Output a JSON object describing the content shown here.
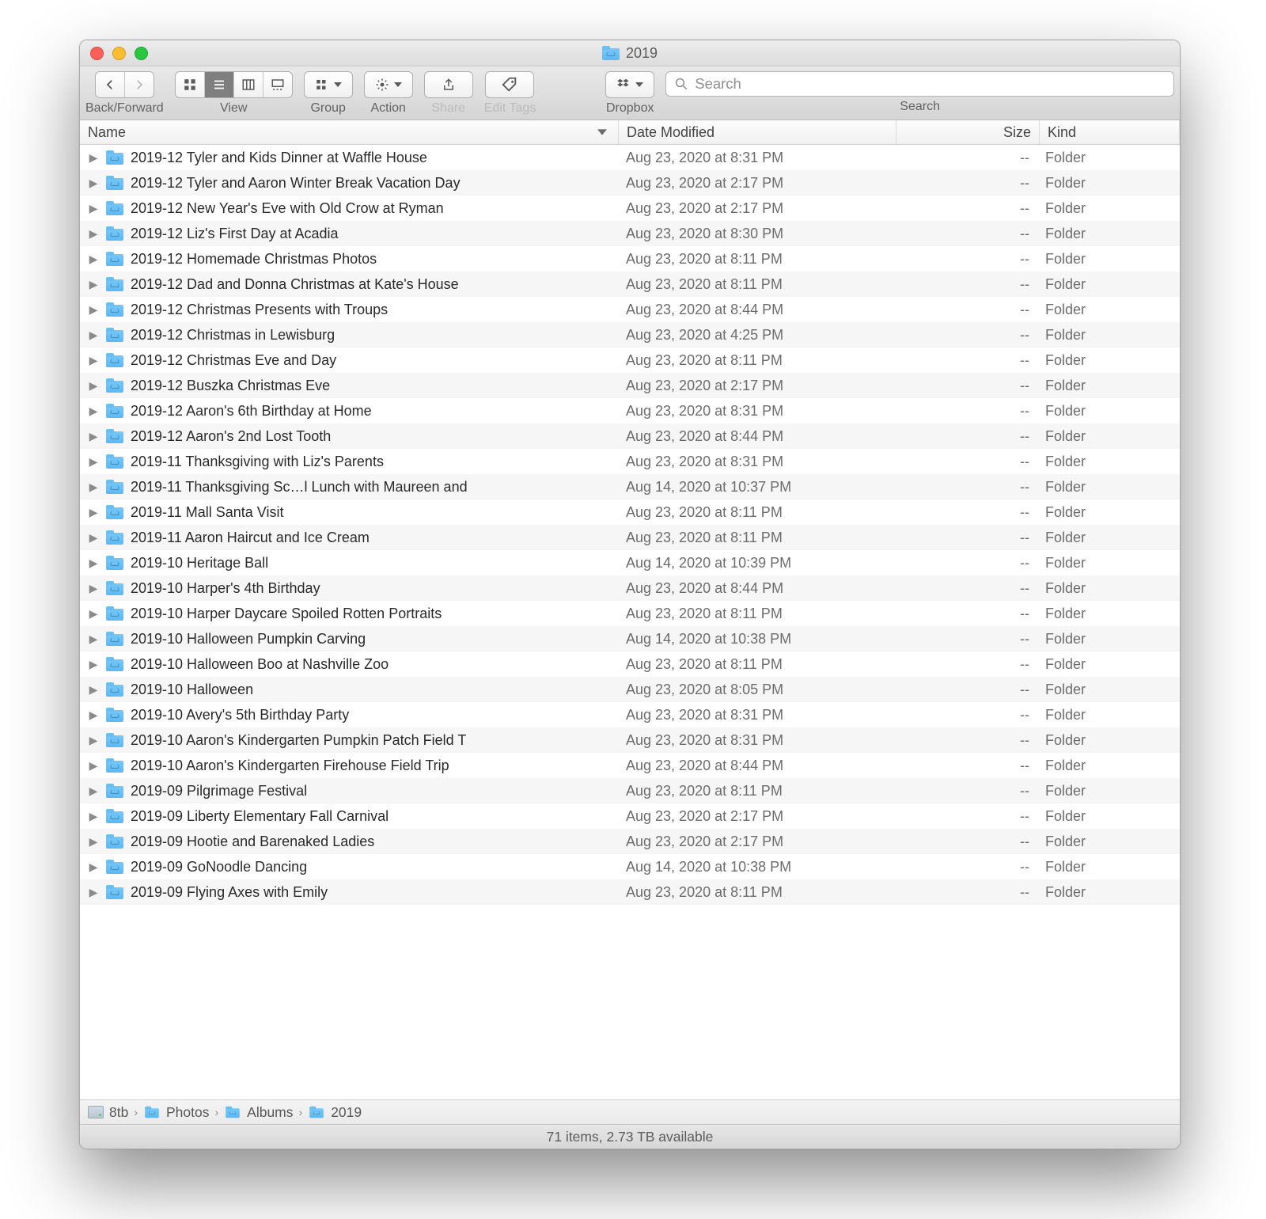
{
  "window": {
    "title": "2019"
  },
  "toolbar": {
    "back_forward_label": "Back/Forward",
    "view_label": "View",
    "group_label": "Group",
    "action_label": "Action",
    "share_label": "Share",
    "tags_label": "Edit Tags",
    "dropbox_label": "Dropbox",
    "search_label": "Search",
    "search_placeholder": "Search"
  },
  "columns": {
    "name": "Name",
    "date": "Date Modified",
    "size": "Size",
    "kind": "Kind"
  },
  "items": [
    {
      "name": "2019-12 Tyler and Kids Dinner at Waffle House",
      "date": "Aug 23, 2020 at 8:31 PM",
      "size": "--",
      "kind": "Folder"
    },
    {
      "name": "2019-12 Tyler and Aaron Winter Break Vacation Day",
      "date": "Aug 23, 2020 at 2:17 PM",
      "size": "--",
      "kind": "Folder"
    },
    {
      "name": "2019-12 New Year's Eve with Old Crow at Ryman",
      "date": "Aug 23, 2020 at 2:17 PM",
      "size": "--",
      "kind": "Folder"
    },
    {
      "name": "2019-12 Liz's First Day at Acadia",
      "date": "Aug 23, 2020 at 8:30 PM",
      "size": "--",
      "kind": "Folder"
    },
    {
      "name": "2019-12 Homemade Christmas Photos",
      "date": "Aug 23, 2020 at 8:11 PM",
      "size": "--",
      "kind": "Folder"
    },
    {
      "name": "2019-12 Dad and Donna Christmas at Kate's House",
      "date": "Aug 23, 2020 at 8:11 PM",
      "size": "--",
      "kind": "Folder"
    },
    {
      "name": "2019-12 Christmas Presents with Troups",
      "date": "Aug 23, 2020 at 8:44 PM",
      "size": "--",
      "kind": "Folder"
    },
    {
      "name": "2019-12 Christmas in Lewisburg",
      "date": "Aug 23, 2020 at 4:25 PM",
      "size": "--",
      "kind": "Folder"
    },
    {
      "name": "2019-12 Christmas Eve and Day",
      "date": "Aug 23, 2020 at 8:11 PM",
      "size": "--",
      "kind": "Folder"
    },
    {
      "name": "2019-12 Buszka Christmas Eve",
      "date": "Aug 23, 2020 at 2:17 PM",
      "size": "--",
      "kind": "Folder"
    },
    {
      "name": "2019-12 Aaron's 6th Birthday at Home",
      "date": "Aug 23, 2020 at 8:31 PM",
      "size": "--",
      "kind": "Folder"
    },
    {
      "name": "2019-12 Aaron's 2nd Lost Tooth",
      "date": "Aug 23, 2020 at 8:44 PM",
      "size": "--",
      "kind": "Folder"
    },
    {
      "name": "2019-11 Thanksgiving with Liz's Parents",
      "date": "Aug 23, 2020 at 8:31 PM",
      "size": "--",
      "kind": "Folder"
    },
    {
      "name": "2019-11 Thanksgiving Sc…l Lunch with Maureen and",
      "date": "Aug 14, 2020 at 10:37 PM",
      "size": "--",
      "kind": "Folder"
    },
    {
      "name": "2019-11 Mall Santa Visit",
      "date": "Aug 23, 2020 at 8:11 PM",
      "size": "--",
      "kind": "Folder"
    },
    {
      "name": "2019-11 Aaron Haircut and Ice Cream",
      "date": "Aug 23, 2020 at 8:11 PM",
      "size": "--",
      "kind": "Folder"
    },
    {
      "name": "2019-10 Heritage Ball",
      "date": "Aug 14, 2020 at 10:39 PM",
      "size": "--",
      "kind": "Folder"
    },
    {
      "name": "2019-10 Harper's 4th Birthday",
      "date": "Aug 23, 2020 at 8:44 PM",
      "size": "--",
      "kind": "Folder"
    },
    {
      "name": "2019-10 Harper Daycare Spoiled Rotten Portraits",
      "date": "Aug 23, 2020 at 8:11 PM",
      "size": "--",
      "kind": "Folder"
    },
    {
      "name": "2019-10 Halloween Pumpkin Carving",
      "date": "Aug 14, 2020 at 10:38 PM",
      "size": "--",
      "kind": "Folder"
    },
    {
      "name": "2019-10 Halloween Boo at Nashville Zoo",
      "date": "Aug 23, 2020 at 8:11 PM",
      "size": "--",
      "kind": "Folder"
    },
    {
      "name": "2019-10 Halloween",
      "date": "Aug 23, 2020 at 8:05 PM",
      "size": "--",
      "kind": "Folder"
    },
    {
      "name": "2019-10 Avery's 5th Birthday Party",
      "date": "Aug 23, 2020 at 8:31 PM",
      "size": "--",
      "kind": "Folder"
    },
    {
      "name": "2019-10 Aaron's Kindergarten Pumpkin Patch Field T",
      "date": "Aug 23, 2020 at 8:31 PM",
      "size": "--",
      "kind": "Folder"
    },
    {
      "name": "2019-10 Aaron's Kindergarten Firehouse Field Trip",
      "date": "Aug 23, 2020 at 8:44 PM",
      "size": "--",
      "kind": "Folder"
    },
    {
      "name": "2019-09 Pilgrimage Festival",
      "date": "Aug 23, 2020 at 8:11 PM",
      "size": "--",
      "kind": "Folder"
    },
    {
      "name": "2019-09 Liberty Elementary Fall Carnival",
      "date": "Aug 23, 2020 at 2:17 PM",
      "size": "--",
      "kind": "Folder"
    },
    {
      "name": "2019-09 Hootie and Barenaked Ladies",
      "date": "Aug 23, 2020 at 2:17 PM",
      "size": "--",
      "kind": "Folder"
    },
    {
      "name": "2019-09 GoNoodle Dancing",
      "date": "Aug 14, 2020 at 10:38 PM",
      "size": "--",
      "kind": "Folder"
    },
    {
      "name": "2019-09 Flying Axes with Emily",
      "date": "Aug 23, 2020 at 8:11 PM",
      "size": "--",
      "kind": "Folder"
    }
  ],
  "path": [
    "8tb",
    "Photos",
    "Albums",
    "2019"
  ],
  "status": "71 items, 2.73 TB available"
}
